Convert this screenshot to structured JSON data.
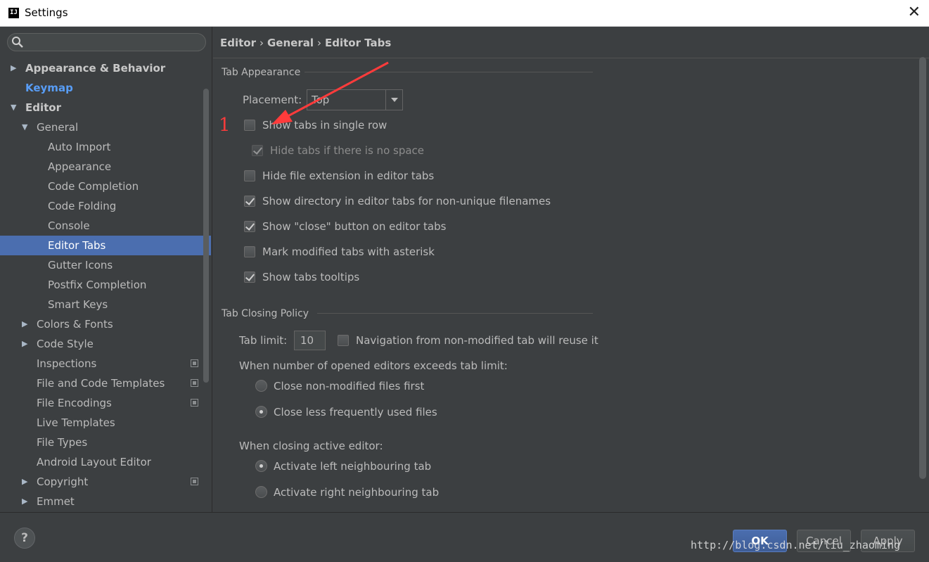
{
  "window": {
    "title": "Settings",
    "app_icon": "IJ",
    "close_symbol": "✕"
  },
  "sidebar": {
    "search_placeholder": "",
    "items": [
      {
        "label": "Appearance & Behavior",
        "level": 0,
        "arrow": "right",
        "style": "bold"
      },
      {
        "label": "Keymap",
        "level": 0,
        "arrow": "none",
        "style": "link"
      },
      {
        "label": "Editor",
        "level": 0,
        "arrow": "down",
        "style": "bold"
      },
      {
        "label": "General",
        "level": 1,
        "arrow": "down"
      },
      {
        "label": "Auto Import",
        "level": 2
      },
      {
        "label": "Appearance",
        "level": 2
      },
      {
        "label": "Code Completion",
        "level": 2
      },
      {
        "label": "Code Folding",
        "level": 2
      },
      {
        "label": "Console",
        "level": 2
      },
      {
        "label": "Editor Tabs",
        "level": 2,
        "selected": true
      },
      {
        "label": "Gutter Icons",
        "level": 2
      },
      {
        "label": "Postfix Completion",
        "level": 2
      },
      {
        "label": "Smart Keys",
        "level": 2
      },
      {
        "label": "Colors & Fonts",
        "level": 1,
        "arrow": "right"
      },
      {
        "label": "Code Style",
        "level": 1,
        "arrow": "right"
      },
      {
        "label": "Inspections",
        "level": 1,
        "project_icon": true
      },
      {
        "label": "File and Code Templates",
        "level": 1,
        "project_icon": true
      },
      {
        "label": "File Encodings",
        "level": 1,
        "project_icon": true
      },
      {
        "label": "Live Templates",
        "level": 1
      },
      {
        "label": "File Types",
        "level": 1
      },
      {
        "label": "Android Layout Editor",
        "level": 1
      },
      {
        "label": "Copyright",
        "level": 1,
        "arrow": "right",
        "project_icon": true
      },
      {
        "label": "Emmet",
        "level": 1,
        "arrow": "right"
      }
    ]
  },
  "breadcrumb": {
    "parts": [
      "Editor",
      "General",
      "Editor Tabs"
    ],
    "separator": "›"
  },
  "tab_appearance": {
    "title": "Tab Appearance",
    "placement_label": "Placement:",
    "placement_value": "Top",
    "options": [
      {
        "label": "Show tabs in single row",
        "checked": false
      },
      {
        "label": "Hide tabs if there is no space",
        "checked": true,
        "disabled": true
      },
      {
        "label": "Hide file extension in editor tabs",
        "checked": false
      },
      {
        "label": "Show directory in editor tabs for non-unique filenames",
        "checked": true
      },
      {
        "label": "Show \"close\" button on editor tabs",
        "checked": true
      },
      {
        "label": "Mark modified tabs with asterisk",
        "checked": false
      },
      {
        "label": "Show tabs tooltips",
        "checked": true
      }
    ]
  },
  "tab_closing": {
    "title": "Tab Closing Policy",
    "tab_limit_label": "Tab limit:",
    "tab_limit_value": "10",
    "nav_reuse": {
      "label": "Navigation from non-modified tab will reuse it",
      "checked": false
    },
    "exceed_label": "When number of opened editors exceeds tab limit:",
    "exceed_options": [
      {
        "label": "Close non-modified files first",
        "selected": false
      },
      {
        "label": "Close less frequently used files",
        "selected": true
      }
    ],
    "closing_label": "When closing active editor:",
    "closing_options": [
      {
        "label": "Activate left neighbouring tab",
        "selected": true
      },
      {
        "label": "Activate right neighbouring tab",
        "selected": false
      }
    ]
  },
  "annotation": {
    "number": "1",
    "color": "#ff3b3b"
  },
  "footer": {
    "help": "?",
    "ok": "OK",
    "cancel": "Cancel",
    "apply": "Apply"
  },
  "watermark": "http://blog.csdn.net/liu_zhaoming",
  "colors": {
    "background": "#3c3f41",
    "selection": "#4b6eaf",
    "link": "#589df6",
    "text": "#bbbbbb"
  }
}
